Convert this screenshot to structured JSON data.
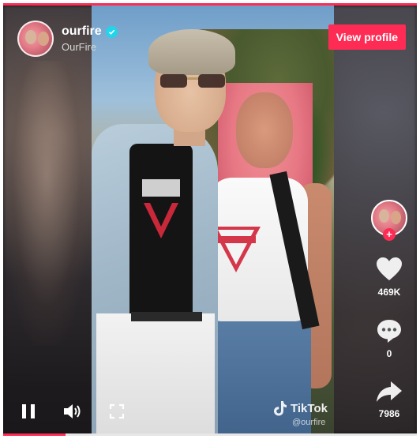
{
  "header": {
    "username": "ourfire",
    "display_name": "OurFire",
    "verified": true
  },
  "view_profile_label": "View profile",
  "actions": {
    "likes": "469K",
    "comments": "0",
    "shares": "7986"
  },
  "watermark": {
    "brand": "TikTok",
    "handle": "@ourfire"
  },
  "player": {
    "state": "playing",
    "progress_fraction": 0.15
  },
  "colors": {
    "accent": "#fe2c55",
    "verified": "#20d5ec"
  },
  "icons": [
    "verified-icon",
    "heart-icon",
    "comment-icon",
    "share-icon",
    "pause-icon",
    "volume-icon",
    "fullscreen-icon",
    "tiktok-logo-icon",
    "follow-plus-icon"
  ]
}
